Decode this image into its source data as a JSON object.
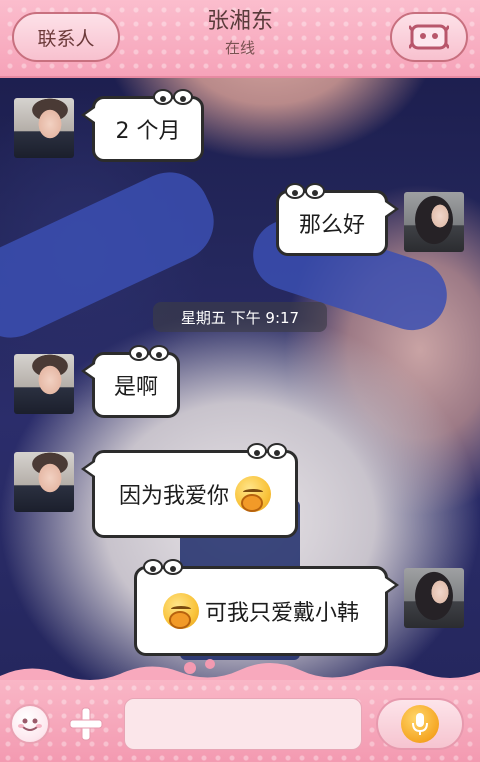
{
  "header": {
    "contacts_label": "联系人",
    "title": "张湘东",
    "status": "在线",
    "profile_icon": "face-icon"
  },
  "messages": [
    {
      "sender": "friend",
      "text": "2 个月",
      "emoji": null
    },
    {
      "sender": "me",
      "text": "那么好",
      "emoji": null
    },
    {
      "sender": "friend",
      "text": "是啊",
      "emoji": null
    },
    {
      "sender": "friend",
      "text": "因为我爱你",
      "emoji": "blushing-face-icon"
    },
    {
      "sender": "me",
      "text": "可我只爱戴小韩",
      "emoji": "blushing-face-icon"
    }
  ],
  "timestamp": "星期五 下午 9:17",
  "input": {
    "value": "",
    "placeholder": ""
  },
  "icons": {
    "emoji_button": "smiley-icon",
    "plus_button": "plus-icon",
    "mic_button": "microphone-icon"
  },
  "colors": {
    "header_pink": "#f6a3b9",
    "bottom_pink": "#f39ab1",
    "mic_orange": "#f5a623"
  }
}
